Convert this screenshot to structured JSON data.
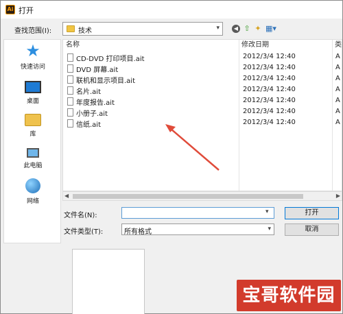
{
  "window": {
    "title": "打开",
    "app_icon_text": "Ai"
  },
  "lookin": {
    "label": "查找范围(I):",
    "value": "技术"
  },
  "toolbar": {
    "back_icon": "back-arrow-icon",
    "up_icon": "up-folder-icon",
    "new_folder_icon": "new-folder-icon",
    "view_icon": "view-menu-icon"
  },
  "places": [
    {
      "label": "快速访问",
      "icon": "star-icon"
    },
    {
      "label": "桌面",
      "icon": "desktop-icon"
    },
    {
      "label": "库",
      "icon": "library-icon"
    },
    {
      "label": "此电脑",
      "icon": "computer-icon"
    },
    {
      "label": "网络",
      "icon": "network-icon"
    }
  ],
  "filelist": {
    "columns": {
      "name": "名称",
      "date": "修改日期",
      "type": "类"
    },
    "files": [
      {
        "name": "CD-DVD 打印项目.ait",
        "date": "2012/3/4 12:40",
        "type": "A"
      },
      {
        "name": "DVD 屏幕.ait",
        "date": "2012/3/4 12:40",
        "type": "A"
      },
      {
        "name": "联机和显示项目.ait",
        "date": "2012/3/4 12:40",
        "type": "A"
      },
      {
        "name": "名片.ait",
        "date": "2012/3/4 12:40",
        "type": "A"
      },
      {
        "name": "年度报告.ait",
        "date": "2012/3/4 12:40",
        "type": "A"
      },
      {
        "name": "小册子.ait",
        "date": "2012/3/4 12:40",
        "type": "A"
      },
      {
        "name": "信纸.ait",
        "date": "2012/3/4 12:40",
        "type": "A"
      }
    ]
  },
  "filename": {
    "label": "文件名(N):",
    "value": ""
  },
  "filetype": {
    "label": "文件类型(T):",
    "value": "所有格式"
  },
  "buttons": {
    "open": "打开",
    "cancel": "取消"
  },
  "watermark": {
    "text": "宝哥软件园"
  },
  "colors": {
    "annotation_arrow": "#e04b3a",
    "accent": "#0078d7",
    "watermark_bg": "#d23b2c"
  }
}
